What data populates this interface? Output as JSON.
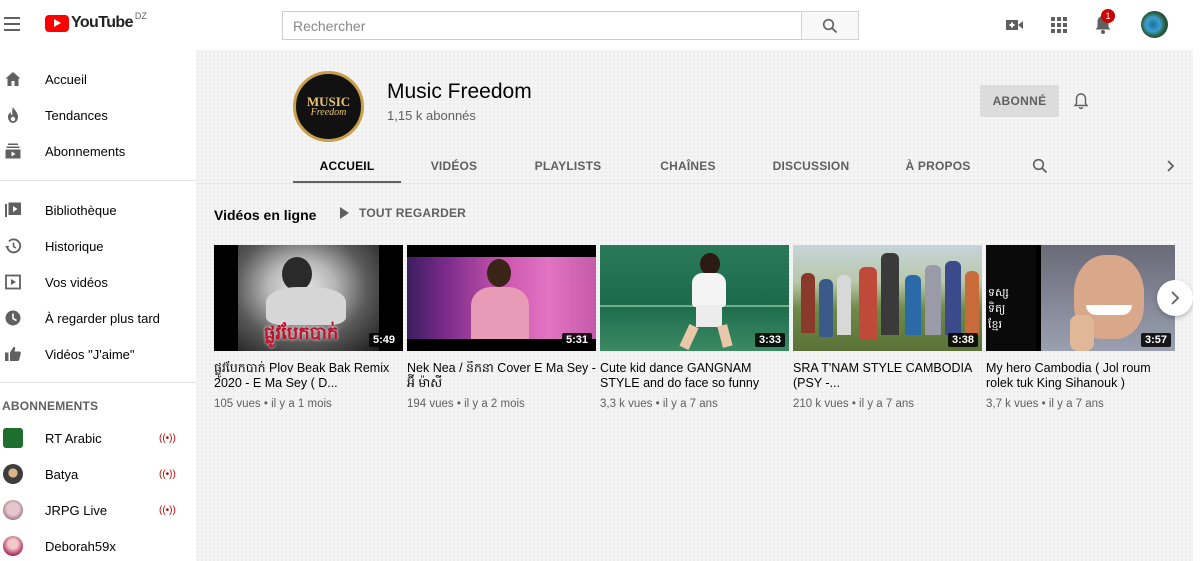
{
  "header": {
    "logo_text": "YouTube",
    "country": "DZ",
    "search_placeholder": "Rechercher",
    "notification_count": "1",
    "icons": [
      "menu-icon",
      "search-icon",
      "create-video-icon",
      "apps-grid-icon",
      "bell-icon",
      "account-avatar"
    ]
  },
  "sidebar": {
    "main_items": [
      {
        "label": "Accueil",
        "icon": "home-icon"
      },
      {
        "label": "Tendances",
        "icon": "fire-icon"
      },
      {
        "label": "Abonnements",
        "icon": "subscriptions-icon"
      }
    ],
    "library_items": [
      {
        "label": "Bibliothèque",
        "icon": "library-icon"
      },
      {
        "label": "Historique",
        "icon": "history-icon"
      },
      {
        "label": "Vos vidéos",
        "icon": "your-videos-icon"
      },
      {
        "label": "À regarder plus tard",
        "icon": "watch-later-icon"
      },
      {
        "label": "Vidéos \"J'aime\"",
        "icon": "thumbs-up-icon"
      }
    ],
    "subscriptions_title": "ABONNEMENTS",
    "subscriptions": [
      {
        "label": "RT Arabic",
        "live": true
      },
      {
        "label": "Batya",
        "live": true
      },
      {
        "label": "JRPG Live",
        "live": true
      },
      {
        "label": "Deborah59x",
        "live": false
      }
    ]
  },
  "channel": {
    "avatar_text_1": "MUSIC",
    "avatar_text_2": "Freedom",
    "name": "Music Freedom",
    "subscribers": "1,15 k abonnés",
    "subscribed_label": "ABONNÉ",
    "accent_color": "#c8a04a"
  },
  "tabs": [
    {
      "label": "ACCUEIL",
      "active": true
    },
    {
      "label": "VIDÉOS",
      "active": false
    },
    {
      "label": "PLAYLISTS",
      "active": false
    },
    {
      "label": "CHAÎNES",
      "active": false
    },
    {
      "label": "DISCUSSION",
      "active": false
    },
    {
      "label": "À PROPOS",
      "active": false
    }
  ],
  "shelf": {
    "title": "Vidéos en ligne",
    "play_all_label": "TOUT REGARDER",
    "videos": [
      {
        "title": "ផ្លូវបែកបាក់ Plov Beak Bak Remix 2020 - E Ma Sey ( D...",
        "meta": "105 vues • il y a 1 mois",
        "duration": "5:49"
      },
      {
        "title": "Nek Nea / នឹកនា Cover E Ma Sey - អ៊ី ម៉ាសី",
        "meta": "194 vues • il y a 2 mois",
        "duration": "5:31"
      },
      {
        "title": "Cute kid dance GANGNAM STYLE and do face so funny",
        "meta": "3,3 k vues • il y a 7 ans",
        "duration": "3:33"
      },
      {
        "title": "SRA T'NAM STYLE CAMBODIA (PSY -...",
        "meta": "210 k vues • il y a 7 ans",
        "duration": "3:38"
      },
      {
        "title": "My hero Cambodia ( Jol roum rolek tuk King Sihanouk )",
        "meta": "3,7 k vues • il y a 7 ans",
        "duration": "3:57"
      }
    ]
  },
  "colors": {
    "brand_red": "#ff0000",
    "live_red": "#cc0000",
    "text_primary": "#030303",
    "text_secondary": "#606060"
  }
}
